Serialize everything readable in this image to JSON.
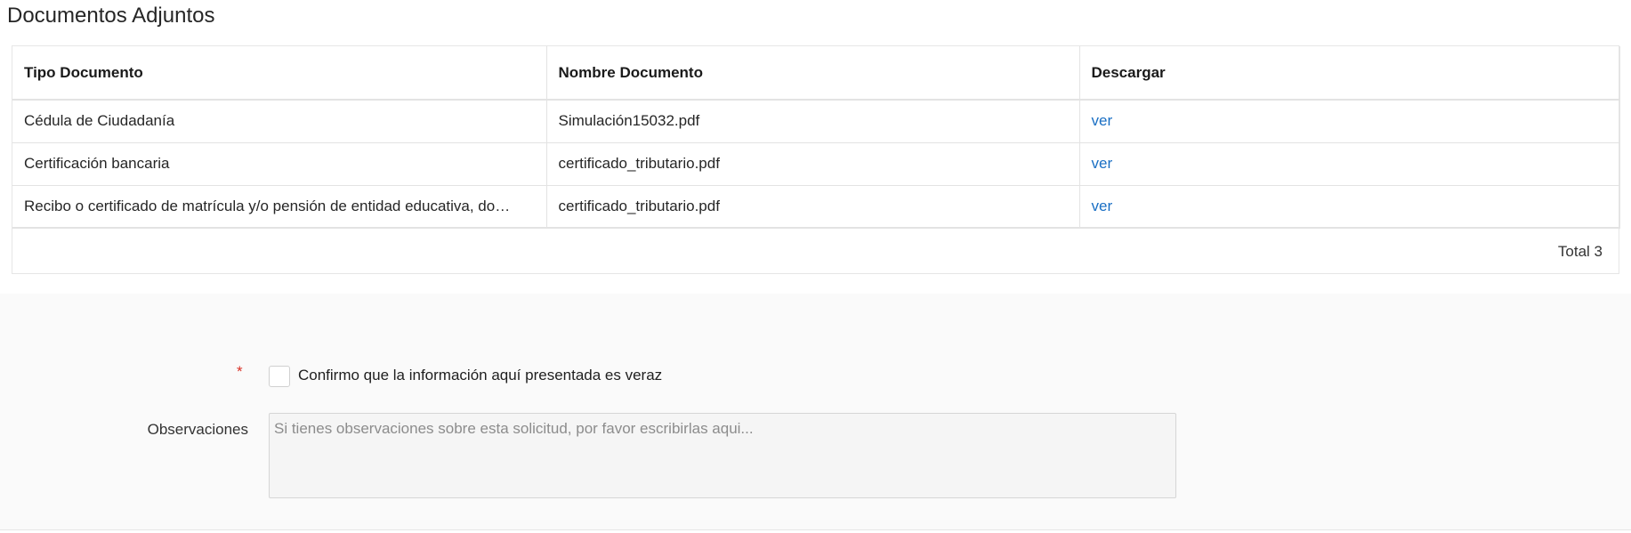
{
  "section": {
    "title": "Documentos Adjuntos"
  },
  "table": {
    "headers": [
      "Tipo Documento",
      "Nombre Documento",
      "Descargar"
    ],
    "rows": [
      {
        "tipo": "Cédula de Ciudadanía",
        "nombre": "Simulación15032.pdf",
        "accion": "ver"
      },
      {
        "tipo": "Certificación bancaria",
        "nombre": "certificado_tributario.pdf",
        "accion": "ver"
      },
      {
        "tipo": "Recibo o certificado de matrícula y/o pensión de entidad educativa, do…",
        "nombre": "certificado_tributario.pdf",
        "accion": "ver"
      }
    ],
    "total_label": "Total 3"
  },
  "form": {
    "required_mark": "*",
    "confirm_label": "Confirmo que la información aquí presentada es veraz",
    "confirm_checked": false,
    "observations_label": "Observaciones",
    "observations_placeholder": "Si tienes observaciones sobre esta solicitud, por favor escribirlas aqui...",
    "observations_value": ""
  },
  "colors": {
    "link": "#1a6fc4",
    "required": "#d93025"
  }
}
